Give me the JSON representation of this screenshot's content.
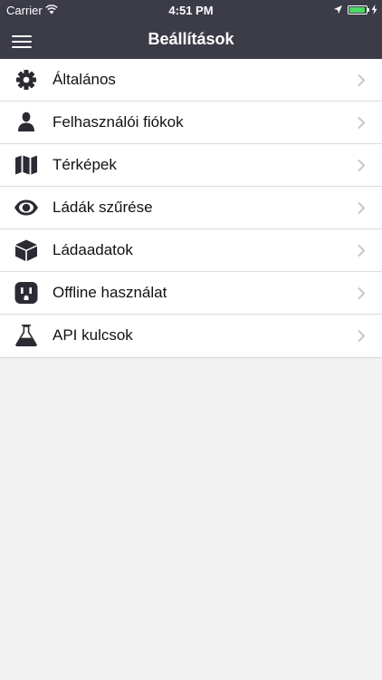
{
  "status_bar": {
    "carrier": "Carrier",
    "time": "4:51 PM",
    "battery_level": 0.95
  },
  "nav_bar": {
    "title": "Beállítások"
  },
  "settings": {
    "items": [
      {
        "label": "Általános",
        "icon": "gear-icon"
      },
      {
        "label": "Felhasználói fiókok",
        "icon": "user-icon"
      },
      {
        "label": "Térképek",
        "icon": "map-icon"
      },
      {
        "label": "Ládák szűrése",
        "icon": "eye-icon"
      },
      {
        "label": "Ládaadatok",
        "icon": "cube-icon"
      },
      {
        "label": "Offline használat",
        "icon": "power-outlet-icon"
      },
      {
        "label": "API kulcsok",
        "icon": "flask-icon"
      }
    ]
  },
  "colors": {
    "nav_background": "#3b3c48",
    "page_background": "#f2f2f2",
    "list_background": "#ffffff",
    "icon": "#2b2b33",
    "chevron": "#c7c7cc",
    "battery": "#4cd964"
  }
}
